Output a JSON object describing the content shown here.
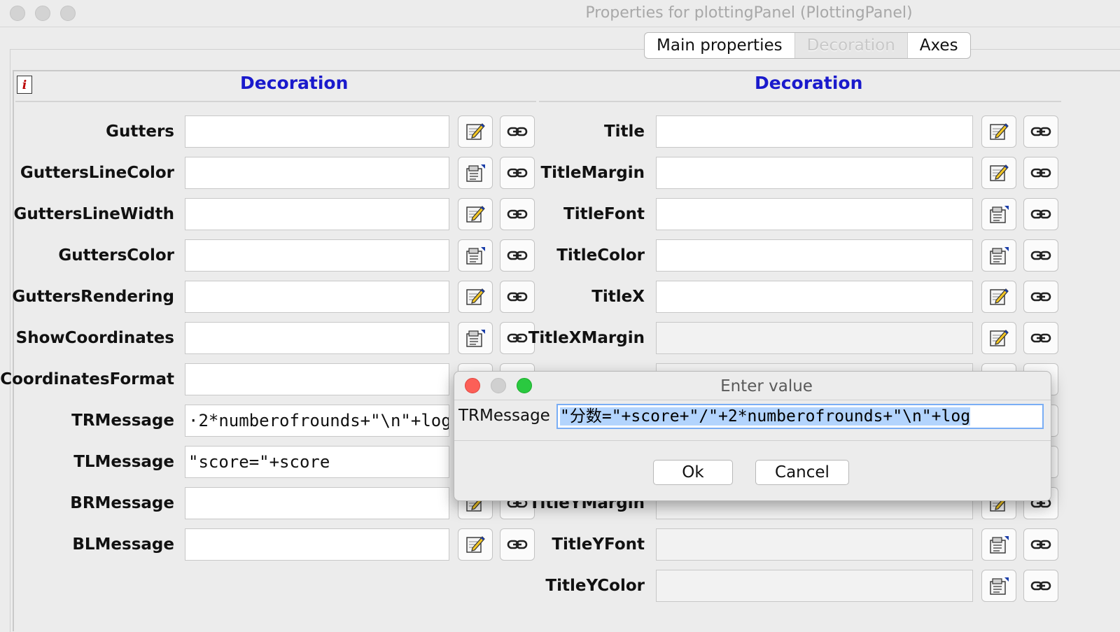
{
  "window": {
    "title": "Properties for plottingPanel (PlottingPanel)"
  },
  "tabs": [
    {
      "label": "Main properties"
    },
    {
      "label": "Decoration",
      "selected": true
    },
    {
      "label": "Axes"
    }
  ],
  "left_section": {
    "title": "Decoration",
    "rows": [
      {
        "label": "Gutters",
        "value": "",
        "editor_icon": "edit-pencil-icon"
      },
      {
        "label": "GuttersLineColor",
        "value": "",
        "editor_icon": "chooser-icon"
      },
      {
        "label": "GuttersLineWidth",
        "value": "",
        "editor_icon": "edit-pencil-icon"
      },
      {
        "label": "GuttersColor",
        "value": "",
        "editor_icon": "chooser-icon"
      },
      {
        "label": "GuttersRendering",
        "value": "",
        "editor_icon": "edit-pencil-icon"
      },
      {
        "label": "ShowCoordinates",
        "value": "",
        "editor_icon": "chooser-icon"
      },
      {
        "label": "CoordinatesFormat",
        "value": "",
        "editor_icon": "edit-pencil-icon"
      },
      {
        "label": "TRMessage",
        "value": "·2*numberofrounds+\"\\n\"+log",
        "editor_icon": "edit-pencil-icon"
      },
      {
        "label": "TLMessage",
        "value": "\"score=\"+score",
        "editor_icon": "edit-pencil-icon"
      },
      {
        "label": "BRMessage",
        "value": "",
        "editor_icon": "edit-pencil-icon"
      },
      {
        "label": "BLMessage",
        "value": "",
        "editor_icon": "edit-pencil-icon"
      }
    ]
  },
  "right_section": {
    "title": "Decoration",
    "rows": [
      {
        "label": "Title",
        "value": "",
        "editor_icon": "edit-pencil-icon"
      },
      {
        "label": "TitleMargin",
        "value": "",
        "editor_icon": "edit-pencil-icon"
      },
      {
        "label": "TitleFont",
        "value": "",
        "editor_icon": "chooser-icon"
      },
      {
        "label": "TitleColor",
        "value": "",
        "editor_icon": "chooser-icon"
      },
      {
        "label": "TitleX",
        "value": "",
        "editor_icon": "edit-pencil-icon"
      },
      {
        "label": "TitleXMargin",
        "value": "",
        "editor_icon": "edit-pencil-icon"
      },
      {
        "label": "",
        "value": "",
        "editor_icon": "chooser-icon"
      },
      {
        "label": "",
        "value": "",
        "editor_icon": "edit-pencil-icon"
      },
      {
        "label": "",
        "value": "",
        "editor_icon": "edit-pencil-icon"
      },
      {
        "label": "TitleYMargin",
        "value": "",
        "editor_icon": "edit-pencil-icon"
      },
      {
        "label": "TitleYFont",
        "value": "",
        "editor_icon": "chooser-icon"
      },
      {
        "label": "TitleYColor",
        "value": "",
        "editor_icon": "chooser-icon"
      }
    ]
  },
  "dialog": {
    "title": "Enter value",
    "field_label": "TRMessage",
    "field_value": "\"分数=\"+score+\"/\"+2*numberofrounds+\"\\n\"+log",
    "ok_label": "Ok",
    "cancel_label": "Cancel"
  },
  "colors": {
    "section_title": "#1a1acc",
    "selection": "#b3d4fd",
    "close": "#fc5f57",
    "zoom": "#2ac940"
  }
}
